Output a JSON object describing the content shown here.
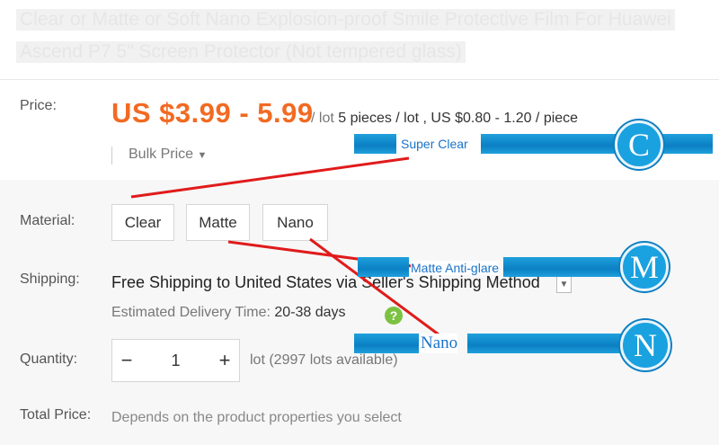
{
  "title": {
    "line1": "Clear or Matte or Soft Nano Explosion-proof Smile Protective Film For Huawei",
    "line2": "Ascend P7 5\" Screen Protector (Not tempered glass)"
  },
  "price": {
    "label": "Price:",
    "range": "US $3.99 - 5.99",
    "unit": "/ lot",
    "per_piece": "5 pieces / lot , US $0.80 - 1.20 / piece",
    "bulk": "Bulk Price"
  },
  "material": {
    "label": "Material:",
    "options": [
      "Clear",
      "Matte",
      "Nano"
    ]
  },
  "shipping": {
    "label": "Shipping:",
    "method": "Free Shipping to United States via Seller's Shipping Method",
    "estimated_label": "Estimated Delivery Time:",
    "estimated_value": "20-38 days",
    "help": "?"
  },
  "quantity": {
    "label": "Quantity:",
    "minus": "−",
    "value": "1",
    "plus": "+",
    "available": "lot (2997 lots available)"
  },
  "total": {
    "label": "Total Price:",
    "value": "Depends on the product properties you select"
  },
  "annotations": {
    "c_label": "Super Clear",
    "c_letter": "C",
    "m_label": "Matte Anti-glare",
    "m_letter": "M",
    "n_label": "Nano",
    "n_letter": "N"
  },
  "colors": {
    "price": "#f26a22",
    "annotation_blue": "#1aa1e0",
    "arrow_red": "#e01b1b"
  }
}
